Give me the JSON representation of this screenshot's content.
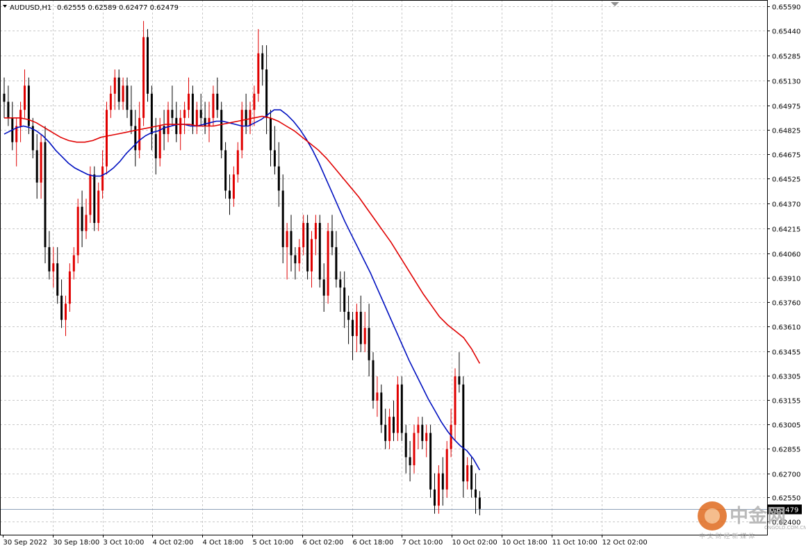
{
  "header": {
    "symbol": "AUDUSD,H1",
    "quote": "0.62555 0.62589 0.62477 0.62479"
  },
  "price_tag": "0.62479",
  "watermark": {
    "name": "中金网",
    "domain": "CNGOLD.COM.CN",
    "tagline": "中 文 财 经 新 媒 体"
  },
  "colors": {
    "bull_candle": "#e00000",
    "bear_candle": "#000000",
    "ma_fast": "#0010c0",
    "ma_slow": "#e00000",
    "grid": "#c8c8c8",
    "bid_line": "#8ea0b8"
  },
  "chart_data": {
    "type": "candlestick",
    "title": "AUDUSD,H1",
    "ylim": [
      0.6232,
      0.6563
    ],
    "y_ticks": [
      0.6559,
      0.6544,
      0.65285,
      0.6513,
      0.64975,
      0.64825,
      0.64675,
      0.64525,
      0.6437,
      0.64215,
      0.6406,
      0.6391,
      0.6376,
      0.6361,
      0.63455,
      0.63305,
      0.63155,
      0.63005,
      0.62855,
      0.627,
      0.6255,
      0.624
    ],
    "x_ticks": [
      "30 Sep 2022",
      "30 Sep 18:00",
      "3 Oct 10:00",
      "4 Oct 02:00",
      "4 Oct 18:00",
      "5 Oct 10:00",
      "6 Oct 02:00",
      "6 Oct 18:00",
      "7 Oct 10:00",
      "10 Oct 02:00",
      "10 Oct 18:00",
      "11 Oct 10:00",
      "12 Oct 02:00"
    ],
    "last_price": 0.62479,
    "candles": [
      [
        0.6505,
        0.6515,
        0.649,
        0.65
      ],
      [
        0.65,
        0.651,
        0.6485,
        0.649
      ],
      [
        0.649,
        0.65,
        0.647,
        0.6475
      ],
      [
        0.6475,
        0.649,
        0.646,
        0.6485
      ],
      [
        0.6485,
        0.65,
        0.6475,
        0.6495
      ],
      [
        0.6495,
        0.652,
        0.649,
        0.651
      ],
      [
        0.651,
        0.6515,
        0.648,
        0.6485
      ],
      [
        0.6485,
        0.649,
        0.6465,
        0.647
      ],
      [
        0.647,
        0.648,
        0.644,
        0.645
      ],
      [
        0.645,
        0.648,
        0.644,
        0.6475
      ],
      [
        0.6475,
        0.6485,
        0.64,
        0.641
      ],
      [
        0.641,
        0.642,
        0.639,
        0.6395
      ],
      [
        0.6395,
        0.641,
        0.6385,
        0.64
      ],
      [
        0.64,
        0.641,
        0.6375,
        0.638
      ],
      [
        0.638,
        0.639,
        0.636,
        0.6365
      ],
      [
        0.6365,
        0.638,
        0.6355,
        0.6375
      ],
      [
        0.6375,
        0.64,
        0.637,
        0.6395
      ],
      [
        0.6395,
        0.641,
        0.639,
        0.6405
      ],
      [
        0.6405,
        0.644,
        0.64,
        0.6435
      ],
      [
        0.6435,
        0.6445,
        0.641,
        0.642
      ],
      [
        0.642,
        0.644,
        0.6415,
        0.643
      ],
      [
        0.643,
        0.646,
        0.6425,
        0.6455
      ],
      [
        0.6455,
        0.646,
        0.642,
        0.6425
      ],
      [
        0.6425,
        0.645,
        0.642,
        0.6445
      ],
      [
        0.6445,
        0.647,
        0.644,
        0.646
      ],
      [
        0.646,
        0.65,
        0.6455,
        0.6495
      ],
      [
        0.6495,
        0.651,
        0.649,
        0.6505
      ],
      [
        0.6505,
        0.652,
        0.6495,
        0.6515
      ],
      [
        0.6515,
        0.652,
        0.6495,
        0.65
      ],
      [
        0.65,
        0.6515,
        0.6495,
        0.651
      ],
      [
        0.651,
        0.6515,
        0.649,
        0.6495
      ],
      [
        0.6495,
        0.651,
        0.648,
        0.6485
      ],
      [
        0.6485,
        0.6495,
        0.646,
        0.647
      ],
      [
        0.647,
        0.65,
        0.6465,
        0.649
      ],
      [
        0.649,
        0.655,
        0.6485,
        0.654
      ],
      [
        0.654,
        0.6545,
        0.65,
        0.6505
      ],
      [
        0.6505,
        0.651,
        0.647,
        0.648
      ],
      [
        0.648,
        0.649,
        0.6455,
        0.6465
      ],
      [
        0.6465,
        0.649,
        0.646,
        0.6485
      ],
      [
        0.6485,
        0.6495,
        0.647,
        0.648
      ],
      [
        0.648,
        0.65,
        0.6475,
        0.6495
      ],
      [
        0.6495,
        0.651,
        0.6485,
        0.649
      ],
      [
        0.649,
        0.65,
        0.6475,
        0.648
      ],
      [
        0.648,
        0.6495,
        0.647,
        0.649
      ],
      [
        0.649,
        0.65,
        0.648,
        0.6495
      ],
      [
        0.6495,
        0.6515,
        0.649,
        0.6505
      ],
      [
        0.6505,
        0.651,
        0.648,
        0.6485
      ],
      [
        0.6485,
        0.65,
        0.648,
        0.6495
      ],
      [
        0.6495,
        0.6505,
        0.6485,
        0.649
      ],
      [
        0.649,
        0.65,
        0.648,
        0.6485
      ],
      [
        0.6485,
        0.65,
        0.6475,
        0.649
      ],
      [
        0.649,
        0.651,
        0.6485,
        0.6505
      ],
      [
        0.6505,
        0.6515,
        0.649,
        0.6495
      ],
      [
        0.6495,
        0.65,
        0.6465,
        0.647
      ],
      [
        0.647,
        0.6475,
        0.644,
        0.6445
      ],
      [
        0.6445,
        0.6455,
        0.643,
        0.644
      ],
      [
        0.644,
        0.646,
        0.6435,
        0.6455
      ],
      [
        0.6455,
        0.6475,
        0.645,
        0.647
      ],
      [
        0.647,
        0.65,
        0.6465,
        0.6495
      ],
      [
        0.6495,
        0.6505,
        0.648,
        0.6485
      ],
      [
        0.6485,
        0.65,
        0.648,
        0.6495
      ],
      [
        0.6495,
        0.651,
        0.6485,
        0.6505
      ],
      [
        0.6505,
        0.6545,
        0.65,
        0.653
      ],
      [
        0.653,
        0.6535,
        0.651,
        0.652
      ],
      [
        0.652,
        0.6535,
        0.648,
        0.649
      ],
      [
        0.649,
        0.6495,
        0.646,
        0.647
      ],
      [
        0.647,
        0.6485,
        0.6455,
        0.646
      ],
      [
        0.646,
        0.6475,
        0.6435,
        0.6445
      ],
      [
        0.6445,
        0.6455,
        0.64,
        0.641
      ],
      [
        0.641,
        0.6425,
        0.639,
        0.642
      ],
      [
        0.642,
        0.643,
        0.6395,
        0.6405
      ],
      [
        0.6405,
        0.641,
        0.639,
        0.64
      ],
      [
        0.64,
        0.6415,
        0.6395,
        0.641
      ],
      [
        0.641,
        0.643,
        0.6405,
        0.6425
      ],
      [
        0.6425,
        0.643,
        0.639,
        0.6395
      ],
      [
        0.6395,
        0.642,
        0.6385,
        0.6415
      ],
      [
        0.6415,
        0.643,
        0.6405,
        0.6425
      ],
      [
        0.6425,
        0.643,
        0.6385,
        0.639
      ],
      [
        0.639,
        0.64,
        0.637,
        0.638
      ],
      [
        0.638,
        0.6425,
        0.6375,
        0.642
      ],
      [
        0.642,
        0.643,
        0.6405,
        0.641
      ],
      [
        0.641,
        0.642,
        0.6385,
        0.639
      ],
      [
        0.639,
        0.6395,
        0.637,
        0.6385
      ],
      [
        0.6385,
        0.6395,
        0.636,
        0.637
      ],
      [
        0.637,
        0.638,
        0.635,
        0.6365
      ],
      [
        0.6365,
        0.637,
        0.634,
        0.6355
      ],
      [
        0.6355,
        0.6375,
        0.6345,
        0.637
      ],
      [
        0.637,
        0.638,
        0.6345,
        0.635
      ],
      [
        0.635,
        0.637,
        0.6345,
        0.636
      ],
      [
        0.636,
        0.6375,
        0.633,
        0.634
      ],
      [
        0.634,
        0.6345,
        0.631,
        0.6315
      ],
      [
        0.6315,
        0.633,
        0.6305,
        0.632
      ],
      [
        0.632,
        0.6325,
        0.6295,
        0.63
      ],
      [
        0.63,
        0.631,
        0.6285,
        0.629
      ],
      [
        0.629,
        0.631,
        0.6285,
        0.6305
      ],
      [
        0.6305,
        0.6315,
        0.629,
        0.6295
      ],
      [
        0.6295,
        0.633,
        0.629,
        0.6325
      ],
      [
        0.6325,
        0.633,
        0.629,
        0.6295
      ],
      [
        0.6295,
        0.63,
        0.627,
        0.628
      ],
      [
        0.628,
        0.629,
        0.6265,
        0.6275
      ],
      [
        0.6275,
        0.63,
        0.627,
        0.6295
      ],
      [
        0.6295,
        0.6305,
        0.6285,
        0.63
      ],
      [
        0.63,
        0.6305,
        0.6285,
        0.629
      ],
      [
        0.629,
        0.63,
        0.628,
        0.6295
      ],
      [
        0.6295,
        0.63,
        0.6255,
        0.626
      ],
      [
        0.626,
        0.627,
        0.6245,
        0.625
      ],
      [
        0.625,
        0.6275,
        0.6245,
        0.627
      ],
      [
        0.627,
        0.628,
        0.625,
        0.626
      ],
      [
        0.626,
        0.629,
        0.6255,
        0.6285
      ],
      [
        0.6285,
        0.631,
        0.628,
        0.63
      ],
      [
        0.63,
        0.6335,
        0.629,
        0.633
      ],
      [
        0.633,
        0.6345,
        0.632,
        0.6325
      ],
      [
        0.6325,
        0.633,
        0.6255,
        0.6265
      ],
      [
        0.6265,
        0.628,
        0.626,
        0.6275
      ],
      [
        0.6275,
        0.628,
        0.6255,
        0.626
      ],
      [
        0.626,
        0.627,
        0.6245,
        0.6255
      ],
      [
        0.6255,
        0.6259,
        0.6244,
        0.6248
      ]
    ],
    "series": [
      {
        "name": "",
        "color": "#0010c0",
        "values": [
          0.648,
          0.6482,
          0.6484,
          0.6485,
          0.6484,
          0.6482,
          0.6479,
          0.6475,
          0.647,
          0.6466,
          0.6462,
          0.6459,
          0.6457,
          0.6455,
          0.6454,
          0.6454,
          0.6456,
          0.6459,
          0.6463,
          0.6468,
          0.6472,
          0.6476,
          0.6479,
          0.6481,
          0.6482,
          0.6484,
          0.6485,
          0.6486,
          0.6486,
          0.6485,
          0.6485,
          0.6486,
          0.6487,
          0.6488,
          0.6488,
          0.6487,
          0.6486,
          0.6485,
          0.6485,
          0.6487,
          0.6489,
          0.6492,
          0.6495,
          0.6495,
          0.6492,
          0.6488,
          0.6483,
          0.6477,
          0.647,
          0.6462,
          0.6453,
          0.6444,
          0.6435,
          0.6426,
          0.6418,
          0.641,
          0.6402,
          0.6394,
          0.6385,
          0.6376,
          0.6367,
          0.6358,
          0.6349,
          0.634,
          0.6332,
          0.6324,
          0.6316,
          0.6309,
          0.6302,
          0.6296,
          0.6291,
          0.6287,
          0.6284,
          0.6279,
          0.6272
        ]
      },
      {
        "name": "",
        "color": "#e00000",
        "values": [
          0.649,
          0.649,
          0.649,
          0.6489,
          0.6487,
          0.6484,
          0.6481,
          0.6478,
          0.6476,
          0.6475,
          0.6475,
          0.6476,
          0.6478,
          0.6479,
          0.648,
          0.6481,
          0.6482,
          0.6483,
          0.6484,
          0.6485,
          0.6486,
          0.6486,
          0.6486,
          0.6486,
          0.6485,
          0.6485,
          0.6485,
          0.6486,
          0.6487,
          0.6488,
          0.6489,
          0.649,
          0.6491,
          0.649,
          0.6488,
          0.6485,
          0.6482,
          0.6478,
          0.6474,
          0.647,
          0.6465,
          0.6459,
          0.6453,
          0.6447,
          0.6441,
          0.6434,
          0.6427,
          0.642,
          0.6413,
          0.6405,
          0.6397,
          0.6389,
          0.6381,
          0.6374,
          0.6367,
          0.6362,
          0.6358,
          0.6354,
          0.6347,
          0.6338
        ]
      }
    ]
  }
}
